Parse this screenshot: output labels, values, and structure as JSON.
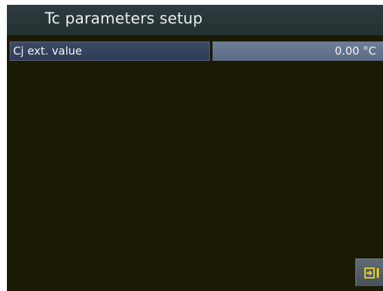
{
  "header": {
    "title": "Tc parameters setup"
  },
  "parameters": [
    {
      "label": "Cj ext. value",
      "value": "0.00 °C"
    }
  ],
  "footer": {
    "exit_icon": "exit-icon"
  },
  "colors": {
    "screen_background": "#1b1a05",
    "title_bar": "#2c3b3d",
    "label_background": "#3c4a66",
    "value_background": "#6e7e97",
    "exit_icon_accent": "#e8d11a"
  }
}
